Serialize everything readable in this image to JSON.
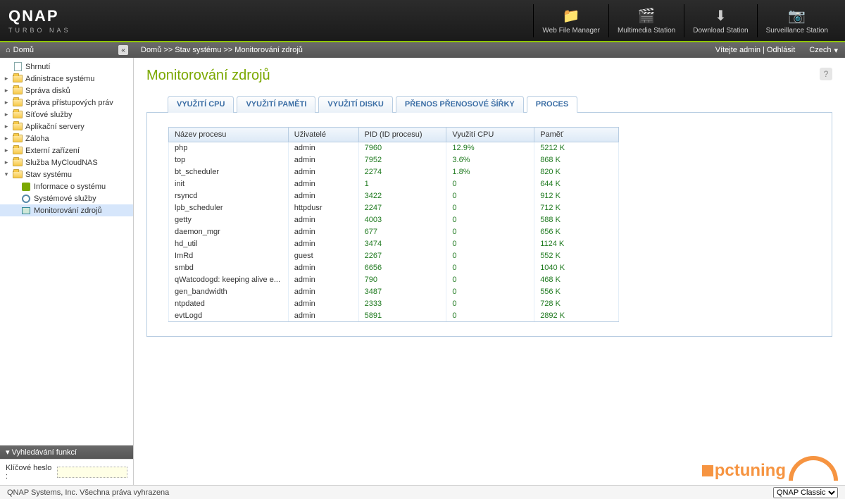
{
  "header": {
    "brand": "QNAP",
    "brand_sub": "TURBO NAS",
    "buttons": [
      {
        "label": "Web File Manager",
        "icon": "folder-search-icon"
      },
      {
        "label": "Multimedia Station",
        "icon": "clapper-icon"
      },
      {
        "label": "Download Station",
        "icon": "download-icon"
      },
      {
        "label": "Surveillance Station",
        "icon": "camera-icon"
      }
    ]
  },
  "breadcrumb": {
    "home": "Domů",
    "path": "Domů >> Stav systému >> Monitorování zdrojů",
    "welcome": "Vítejte admin",
    "logout": "Odhlásit",
    "language": "Czech"
  },
  "sidebar": {
    "items": [
      {
        "label": "Shrnutí",
        "icon": "doc",
        "expand": ""
      },
      {
        "label": "Adinistrace systému",
        "icon": "folder",
        "expand": "▸"
      },
      {
        "label": "Správa disků",
        "icon": "folder",
        "expand": "▸"
      },
      {
        "label": "Správa přístupových práv",
        "icon": "folder",
        "expand": "▸"
      },
      {
        "label": "Síťové služby",
        "icon": "folder",
        "expand": "▸"
      },
      {
        "label": "Aplikační servery",
        "icon": "folder",
        "expand": "▸"
      },
      {
        "label": "Záloha",
        "icon": "folder",
        "expand": "▸"
      },
      {
        "label": "Externí zařízení",
        "icon": "folder",
        "expand": "▸"
      },
      {
        "label": "Služba MyCloudNAS",
        "icon": "folder",
        "expand": "▸"
      },
      {
        "label": "Stav systému",
        "icon": "folder",
        "expand": "▾",
        "expanded": true
      }
    ],
    "subitems": [
      {
        "label": "Informace o systému",
        "icon": "sq"
      },
      {
        "label": "Systémové služby",
        "icon": "gear"
      },
      {
        "label": "Monitorování zdrojů",
        "icon": "mon",
        "selected": true
      }
    ],
    "search_title": "Vyhledávání funkcí",
    "search_label": "Klíčové heslo :"
  },
  "page": {
    "title": "Monitorování zdrojů",
    "tabs": [
      {
        "label": "VYUŽITÍ CPU"
      },
      {
        "label": "VYUŽITÍ PAMĚTI"
      },
      {
        "label": "VYUŽITÍ DISKU"
      },
      {
        "label": "PŘENOS PŘENOSOVÉ ŠÍŘKY"
      },
      {
        "label": "PROCES",
        "active": true
      }
    ],
    "columns": [
      "Název procesu",
      "Uživatelé",
      "PID (ID procesu)",
      "Využití CPU",
      "Paměť"
    ],
    "rows": [
      {
        "name": "php",
        "user": "admin",
        "pid": "7960",
        "cpu": "12.9%",
        "mem": "5212 K"
      },
      {
        "name": "top",
        "user": "admin",
        "pid": "7952",
        "cpu": "3.6%",
        "mem": "868 K"
      },
      {
        "name": "bt_scheduler",
        "user": "admin",
        "pid": "2274",
        "cpu": "1.8%",
        "mem": "820 K"
      },
      {
        "name": "init",
        "user": "admin",
        "pid": "1",
        "cpu": "0",
        "mem": "644 K"
      },
      {
        "name": "rsyncd",
        "user": "admin",
        "pid": "3422",
        "cpu": "0",
        "mem": "912 K"
      },
      {
        "name": "lpb_scheduler",
        "user": "httpdusr",
        "pid": "2247",
        "cpu": "0",
        "mem": "712 K"
      },
      {
        "name": "getty",
        "user": "admin",
        "pid": "4003",
        "cpu": "0",
        "mem": "588 K"
      },
      {
        "name": "daemon_mgr",
        "user": "admin",
        "pid": "677",
        "cpu": "0",
        "mem": "656 K"
      },
      {
        "name": "hd_util",
        "user": "admin",
        "pid": "3474",
        "cpu": "0",
        "mem": "1124 K"
      },
      {
        "name": "ImRd",
        "user": "guest",
        "pid": "2267",
        "cpu": "0",
        "mem": "552 K"
      },
      {
        "name": "smbd",
        "user": "admin",
        "pid": "6656",
        "cpu": "0",
        "mem": "1040 K"
      },
      {
        "name": "qWatcodogd: keeping alive e...",
        "user": "admin",
        "pid": "790",
        "cpu": "0",
        "mem": "468 K"
      },
      {
        "name": "gen_bandwidth",
        "user": "admin",
        "pid": "3487",
        "cpu": "0",
        "mem": "556 K"
      },
      {
        "name": "ntpdated",
        "user": "admin",
        "pid": "2333",
        "cpu": "0",
        "mem": "728 K"
      },
      {
        "name": "evtLogd",
        "user": "admin",
        "pid": "5891",
        "cpu": "0",
        "mem": "2892 K"
      }
    ]
  },
  "footer": {
    "copyright": "QNAP Systems, Inc. Všechna práva vyhrazena",
    "theme": "QNAP Classic"
  }
}
